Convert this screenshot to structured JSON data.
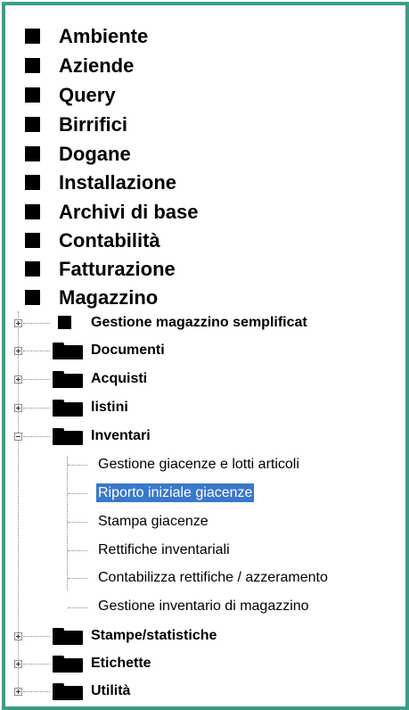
{
  "tree": {
    "top_items": [
      {
        "label": "Ambiente"
      },
      {
        "label": "Aziende"
      },
      {
        "label": "Query"
      },
      {
        "label": "Birrifici"
      },
      {
        "label": "Dogane"
      },
      {
        "label": "Installazione"
      },
      {
        "label": "Archivi di base"
      },
      {
        "label": "Contabilità"
      },
      {
        "label": "Fatturazione"
      },
      {
        "label": "Magazzino"
      }
    ],
    "magazzino_children": [
      {
        "label": "Gestione magazzino semplificat",
        "icon": "square-icon",
        "expanded": false
      },
      {
        "label": "Documenti",
        "icon": "folder-icon",
        "expanded": false
      },
      {
        "label": "Acquisti",
        "icon": "folder-icon",
        "expanded": false
      },
      {
        "label": "listini",
        "icon": "folder-icon",
        "expanded": false
      },
      {
        "label": "Inventari",
        "icon": "folder-icon",
        "expanded": true
      },
      {
        "label": "Stampe/statistiche",
        "icon": "folder-icon",
        "expanded": false
      },
      {
        "label": "Etichette",
        "icon": "folder-icon",
        "expanded": false
      },
      {
        "label": "Utilità",
        "icon": "folder-icon",
        "expanded": false
      }
    ],
    "inventari_children": [
      {
        "label": "Gestione giacenze e lotti articoli",
        "selected": false
      },
      {
        "label": "Riporto iniziale giacenze",
        "selected": true
      },
      {
        "label": "Stampa giacenze",
        "selected": false
      },
      {
        "label": "Rettifiche inventariali",
        "selected": false
      },
      {
        "label": "Contabilizza rettifiche / azzeramento",
        "selected": false
      },
      {
        "label": "Gestione inventario di magazzino",
        "selected": false
      }
    ]
  },
  "colors": {
    "frame_border": "#3a9e86",
    "selection_bg": "#3a78c9",
    "selection_text": "#ffffff"
  }
}
